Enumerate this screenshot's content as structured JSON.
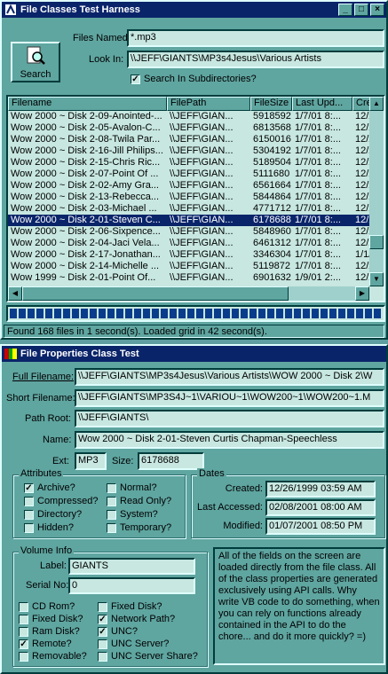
{
  "window1": {
    "title": "File Classes Test Harness",
    "minimize": "_",
    "maximize": "□",
    "close": "×",
    "search_button": "Search",
    "files_named_label": "Files Named:",
    "files_named_value": "*.mp3",
    "look_in_label": "Look In:",
    "look_in_value": "\\\\JEFF\\GIANTS\\MP3s4Jesus\\Various Artists",
    "search_subdirs_label": "Search In Subdirectories?",
    "search_subdirs_checked": true,
    "columns": [
      "Filename",
      "FilePath",
      "FileSize",
      "Last Upd...",
      "Crea"
    ],
    "rows": [
      [
        "Wow 2000 ~ Disk 2-09-Anointed-...",
        "\\\\JEFF\\GIAN...",
        "5918592",
        "1/7/01 8:...",
        "12/2"
      ],
      [
        "Wow 2000 ~ Disk 2-05-Avalon-C...",
        "\\\\JEFF\\GIAN...",
        "6813568",
        "1/7/01 8:...",
        "12/2"
      ],
      [
        "Wow 2000 ~ Disk 2-08-Twila Par...",
        "\\\\JEFF\\GIAN...",
        "6150016",
        "1/7/01 8:...",
        "12/2"
      ],
      [
        "Wow 2000 ~ Disk 2-16-Jill Philips...",
        "\\\\JEFF\\GIAN...",
        "5304192",
        "1/7/01 8:...",
        "12/2"
      ],
      [
        "Wow 2000 ~ Disk 2-15-Chris Ric...",
        "\\\\JEFF\\GIAN...",
        "5189504",
        "1/7/01 8:...",
        "12/2"
      ],
      [
        "Wow 2000 ~ Disk 2-07-Point Of ...",
        "\\\\JEFF\\GIAN...",
        "5111680",
        "1/7/01 8:...",
        "12/2"
      ],
      [
        "Wow 2000 ~ Disk 2-02-Amy Gra...",
        "\\\\JEFF\\GIAN...",
        "6561664",
        "1/7/01 8:...",
        "12/2"
      ],
      [
        "Wow 2000 ~ Disk 2-13-Rebecca...",
        "\\\\JEFF\\GIAN...",
        "5844864",
        "1/7/01 8:...",
        "12/2"
      ],
      [
        "Wow 2000 ~ Disk 2-03-Michael ...",
        "\\\\JEFF\\GIAN...",
        "4771712",
        "1/7/01 8:...",
        "12/2"
      ],
      [
        "Wow 2000 ~ Disk 2-01-Steven C...",
        "\\\\JEFF\\GIAN...",
        "6178688",
        "1/7/01 8:...",
        "12/2"
      ],
      [
        "Wow 2000 ~ Disk 2-06-Sixpence...",
        "\\\\JEFF\\GIAN...",
        "5848960",
        "1/7/01 8:...",
        "12/2"
      ],
      [
        "Wow 2000 ~ Disk 2-04-Jaci Vela...",
        "\\\\JEFF\\GIAN...",
        "6461312",
        "1/7/01 8:...",
        "12/2"
      ],
      [
        "Wow 2000 ~ Disk 2-17-Jonathan...",
        "\\\\JEFF\\GIAN...",
        "3346304",
        "1/7/01 8:...",
        "1/1/"
      ],
      [
        "Wow 2000 ~ Disk 2-14-Michelle ...",
        "\\\\JEFF\\GIAN...",
        "5119872",
        "1/7/01 8:...",
        "12/2"
      ],
      [
        "Wow 1999 ~ Disk 2-01-Point Of...",
        "\\\\JEFF\\GIAN...",
        "6901632",
        "1/9/01 2:...",
        "12/2"
      ]
    ],
    "selected_row": 9,
    "progress_fraction": 1.0,
    "status_text": "Found 168 files in 1 second(s).  Loaded grid in 42 second(s)."
  },
  "window2": {
    "title": "File Properties Class Test",
    "full_filename_label": "Full Filename:",
    "full_filename_value": "\\\\JEFF\\GIANTS\\MP3s4Jesus\\Various Artists\\WOW 2000 ~ Disk 2\\W",
    "short_filename_label": "Short Filename:",
    "short_filename_value": "\\\\JEFF\\GIANTS\\MP3S4J~1\\VARIOU~1\\WOW200~1\\WOW200~1.M",
    "path_root_label": "Path Root:",
    "path_root_value": "\\\\JEFF\\GIANTS\\",
    "name_label": "Name:",
    "name_value": "Wow 2000 ~ Disk 2-01-Steven Curtis Chapman-Speechless",
    "ext_label": "Ext:",
    "ext_value": "MP3",
    "size_label": "Size:",
    "size_value": "6178688",
    "attributes_label": "Attributes",
    "attributes": [
      {
        "label": "Archive?",
        "checked": true
      },
      {
        "label": "Compressed?",
        "checked": false
      },
      {
        "label": "Directory?",
        "checked": false
      },
      {
        "label": "Hidden?",
        "checked": false
      },
      {
        "label": "Normal?",
        "checked": false
      },
      {
        "label": "Read Only?",
        "checked": false
      },
      {
        "label": "System?",
        "checked": false
      },
      {
        "label": "Temporary?",
        "checked": false
      }
    ],
    "dates_label": "Dates",
    "created_label": "Created:",
    "created_value": "12/26/1999 03:59 AM",
    "last_accessed_label": "Last Accessed:",
    "last_accessed_value": "02/08/2001 08:00 AM",
    "modified_label": "Modified:",
    "modified_value": "01/07/2001 08:50 PM",
    "volume_label": "Volume Info",
    "vol_label_label": "Label:",
    "vol_label_value": "GIANTS",
    "serial_label": "Serial No:",
    "serial_value": "0",
    "volume_flags": [
      {
        "label": "CD Rom?",
        "checked": false
      },
      {
        "label": "Fixed Disk?",
        "checked": false
      },
      {
        "label": "Ram Disk?",
        "checked": false
      },
      {
        "label": "Remote?",
        "checked": true
      },
      {
        "label": "Removable?",
        "checked": false
      },
      {
        "label": "Fixed Disk?",
        "checked": false
      },
      {
        "label": "Network Path?",
        "checked": true
      },
      {
        "label": "UNC?",
        "checked": true
      },
      {
        "label": "UNC Server?",
        "checked": false
      },
      {
        "label": "UNC Server Share?",
        "checked": false
      }
    ],
    "memo": "All of the fields on the screen are loaded directly from the file class.  All of the class properties are generated exclusively using API calls.  Why write VB code to do something, when you can rely on functions already contained in the API to do the chore... and do it more quickly?  =)"
  },
  "colors": {
    "window_bg": "#5fa5a0",
    "field_bg": "#c7e7e0",
    "title_bg": "#0a246a",
    "selection_bg": "#0a246a",
    "progress_fill": "#0a3c8c"
  }
}
